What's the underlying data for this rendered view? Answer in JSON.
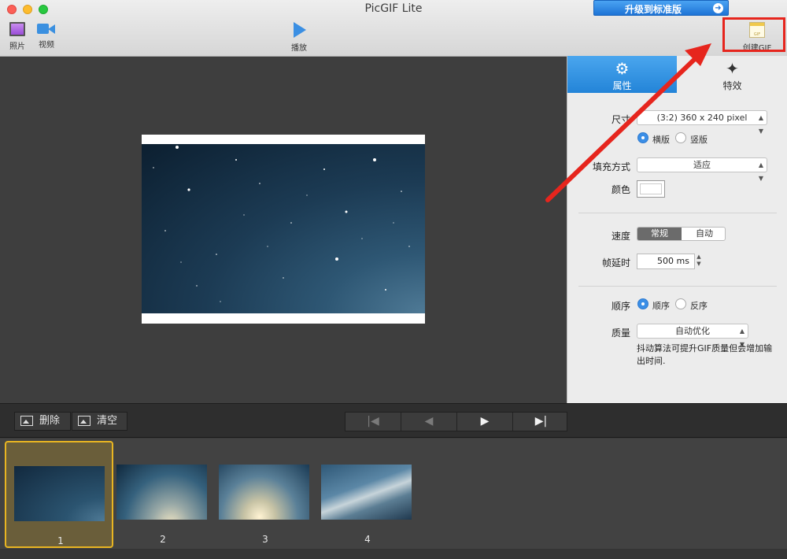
{
  "window": {
    "title": "PicGIF Lite",
    "upgrade_label": "升级到标准版"
  },
  "toolbar": {
    "photo_label": "照片",
    "video_label": "视频",
    "play_label": "播放",
    "create_gif_label": "创建GIF",
    "gif_icon_text": "GIF"
  },
  "tabs": {
    "attributes": "属性",
    "effects": "特效"
  },
  "settings": {
    "size_label": "尺寸",
    "size_value": "(3:2) 360 x 240 pixel",
    "landscape_label": "横版",
    "portrait_label": "竖版",
    "fill_label": "填充方式",
    "fill_value": "适应",
    "color_label": "颜色",
    "speed_label": "速度",
    "speed_normal": "常规",
    "speed_auto": "自动",
    "frame_delay_label": "帧延时",
    "frame_delay_value": "500 ms",
    "order_label": "顺序",
    "order_forward": "顺序",
    "order_reverse": "反序",
    "quality_label": "质量",
    "quality_value": "自动优化",
    "dither_note": "抖动算法可提升GIF质量但会增加输出时间."
  },
  "controls": {
    "delete_label": "删除",
    "clear_label": "清空"
  },
  "frames": [
    {
      "number": "1",
      "selected": true
    },
    {
      "number": "2",
      "selected": false
    },
    {
      "number": "3",
      "selected": false
    },
    {
      "number": "4",
      "selected": false
    }
  ],
  "colors": {
    "accent": "#2384d8",
    "highlight": "#e6251d",
    "selection": "#e8b522"
  }
}
